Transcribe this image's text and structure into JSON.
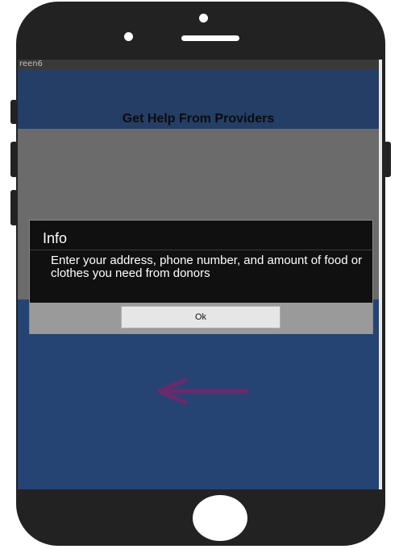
{
  "status_bar": {
    "screen_name": "reen6"
  },
  "header": {
    "title": "Get Help From Providers"
  },
  "dialog": {
    "title": "Info",
    "message": "Enter your address, phone number, and amount of food or clothes you need from donors",
    "ok_label": "Ok"
  },
  "icons": {
    "back": "left-arrow-icon"
  },
  "colors": {
    "screen_background": "#254473",
    "header_background": "#243e66",
    "overlay_gray": "#6b6b6b",
    "dialog_background": "#101010",
    "arrow": "#6a2a6e"
  }
}
